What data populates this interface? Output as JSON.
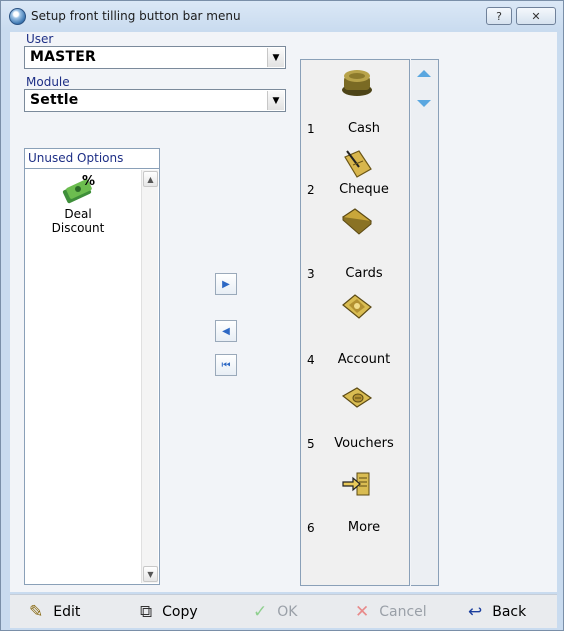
{
  "window": {
    "title": "Setup front tilling button bar menu",
    "help_glyph": "?",
    "close_glyph": "✕"
  },
  "user": {
    "label": "User",
    "value": "MASTER"
  },
  "module": {
    "label": "Module",
    "value": "Settle"
  },
  "unused": {
    "header": "Unused Options",
    "items": [
      {
        "line1": "Deal",
        "line2": "Discount",
        "icon": "deal-discount-icon"
      }
    ]
  },
  "move_buttons": [
    {
      "name": "move-right",
      "glyph": "▶"
    },
    {
      "name": "move-left",
      "glyph": "◀"
    },
    {
      "name": "move-first",
      "glyph": "⏮"
    }
  ],
  "bar": {
    "items": [
      {
        "num": "1",
        "label": "Cash",
        "icon": "cash-icon"
      },
      {
        "num": "2",
        "label": "Cheque",
        "icon": "cheque-icon"
      },
      {
        "num": "3",
        "label": "Cards",
        "icon": "cards-icon"
      },
      {
        "num": "4",
        "label": "Account",
        "icon": "account-icon"
      },
      {
        "num": "5",
        "label": "Vouchers",
        "icon": "vouchers-icon"
      },
      {
        "num": "6",
        "label": "More",
        "icon": "more-icon"
      }
    ]
  },
  "toolbar": {
    "edit": "Edit",
    "copy": "Copy",
    "ok": "OK",
    "cancel": "Cancel",
    "back": "Back"
  },
  "colors": {
    "accent_label": "#1e2f86",
    "arrow_blue": "#5aa7e0",
    "icon_gold": "#c9a63a"
  }
}
